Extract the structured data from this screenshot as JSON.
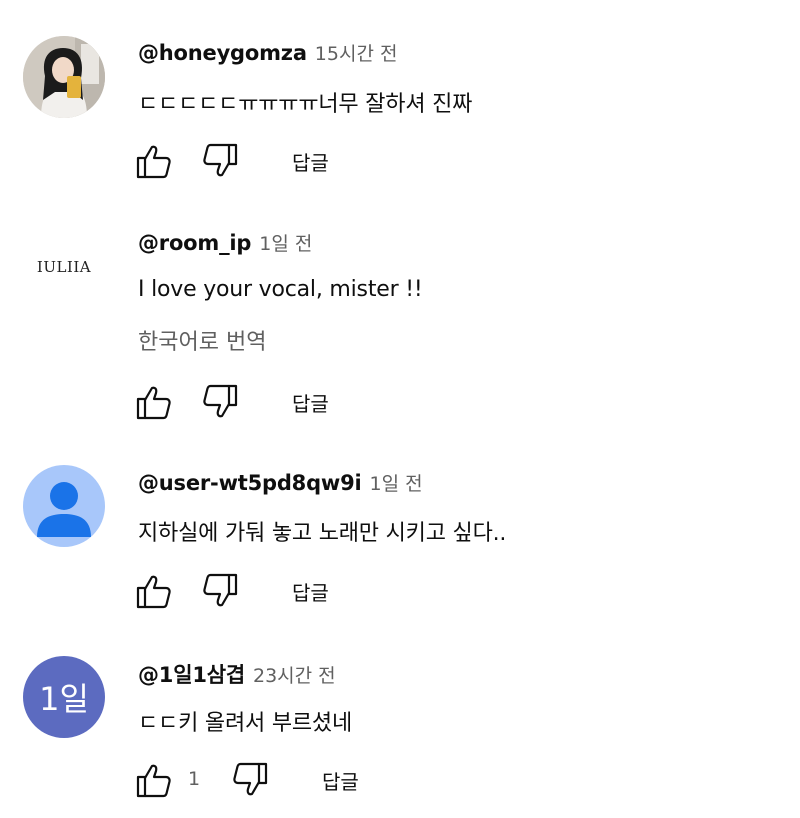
{
  "comments": [
    {
      "author": "@honeygomza",
      "time": "15시간 전",
      "text": "ㄷㄷㄷㄷㄷㅠㅠㅠㅠ너무 잘하셔 진짜",
      "reply_label": "답글"
    },
    {
      "author": "@room_ip",
      "time": "1일 전",
      "text": "I love your vocal, mister !!",
      "translate_label": "한국어로 번역",
      "avatar_text": "IULIIA",
      "reply_label": "답글"
    },
    {
      "author": "@user-wt5pd8qw9i",
      "time": "1일 전",
      "text": "지하실에 가둬 놓고 노래만 시키고 싶다..",
      "avatar_bg": "#a8c7fa",
      "avatar_fg": "#1a73e8",
      "reply_label": "답글"
    },
    {
      "author": "@1일1삼겹",
      "time": "23시간 전",
      "text": "ㄷㄷ키 올려서 부르셨네",
      "avatar_text": "1일",
      "avatar_bg": "#5c6bc0",
      "like_count": "1",
      "reply_label": "답글"
    }
  ],
  "icons": {
    "like": "thumb-up-icon",
    "dislike": "thumb-down-icon",
    "default_avatar": "person-icon"
  }
}
